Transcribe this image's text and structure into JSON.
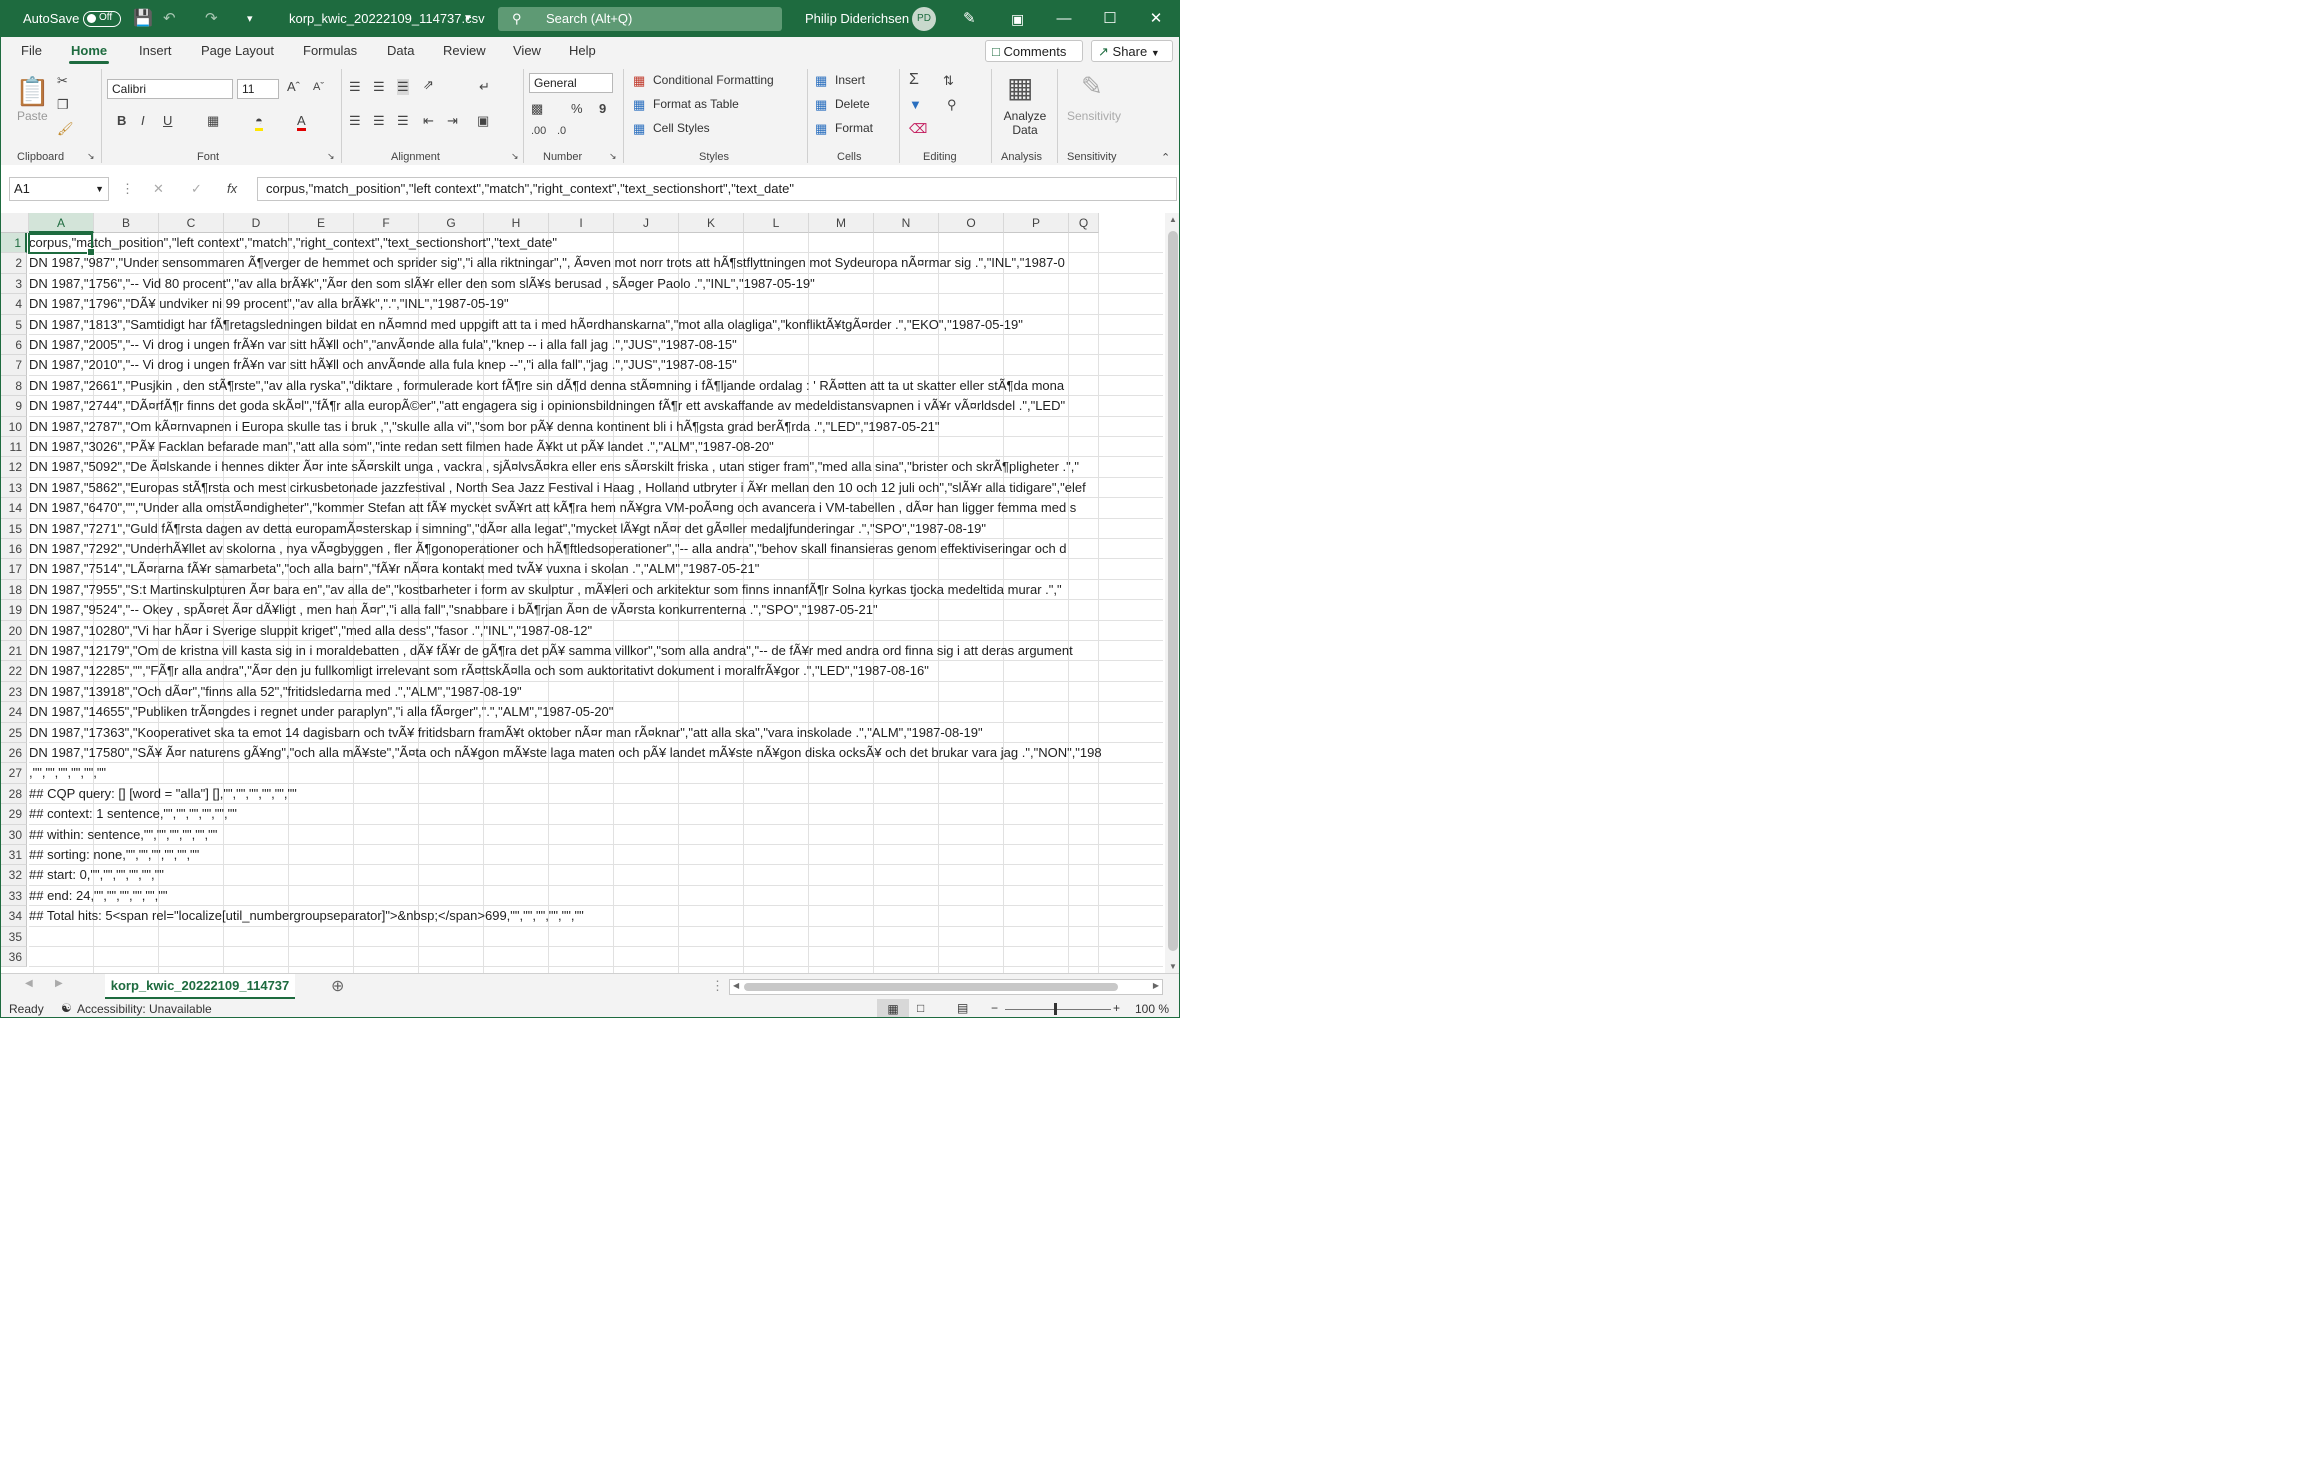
{
  "titlebar": {
    "autosave_label": "AutoSave",
    "autosave_state": "Off",
    "filename": "korp_kwic_20222109_114737.csv",
    "search_placeholder": "Search (Alt+Q)",
    "user_name": "Philip Diderichsen",
    "user_initials": "PD"
  },
  "tabs": [
    "File",
    "Home",
    "Insert",
    "Page Layout",
    "Formulas",
    "Data",
    "Review",
    "View",
    "Help"
  ],
  "tab_actions": {
    "comments": "Comments",
    "share": "Share"
  },
  "ribbon": {
    "clipboard": {
      "paste": "Paste",
      "label": "Clipboard"
    },
    "font": {
      "name": "Calibri",
      "size": "11",
      "label": "Font"
    },
    "alignment": {
      "label": "Alignment"
    },
    "number": {
      "format": "General",
      "label": "Number"
    },
    "styles": {
      "conditional": "Conditional Formatting",
      "table": "Format as Table",
      "cell_styles": "Cell Styles",
      "label": "Styles"
    },
    "cells": {
      "insert": "Insert",
      "delete": "Delete",
      "format": "Format",
      "label": "Cells"
    },
    "editing": {
      "label": "Editing"
    },
    "analysis": {
      "analyze": "Analyze Data",
      "label": "Analysis"
    },
    "sensitivity": {
      "sensitivity": "Sensitivity",
      "label": "Sensitivity"
    }
  },
  "formula_bar": {
    "name_box": "A1",
    "fx": "fx",
    "formula": "corpus,\"match_position\",\"left context\",\"match\",\"right_context\",\"text_sectionshort\",\"text_date\""
  },
  "columns": [
    "A",
    "B",
    "C",
    "D",
    "E",
    "F",
    "G",
    "H",
    "I",
    "J",
    "K",
    "L",
    "M",
    "N",
    "O",
    "P",
    "Q"
  ],
  "rows": [
    "corpus,\"match_position\",\"left context\",\"match\",\"right_context\",\"text_sectionshort\",\"text_date\"",
    "DN 1987,\"987\",\"Under sensommaren Ã¶verger de hemmet och sprider sig\",\"i alla riktningar\",\", Ã¤ven mot norr trots att hÃ¶stflyttningen mot Sydeuropa nÃ¤rmar sig .\",\"INL\",\"1987-0",
    "DN 1987,\"1756\",\"-- Vid 80 procent\",\"av alla brÃ¥k\",\"Ã¤r den som slÃ¥r eller den som slÃ¥s berusad , sÃ¤ger Paolo .\",\"INL\",\"1987-05-19\"",
    "DN 1987,\"1796\",\"DÃ¥ undviker ni 99 procent\",\"av alla brÃ¥k\",\".\",\"INL\",\"1987-05-19\"",
    "DN 1987,\"1813\",\"Samtidigt har fÃ¶retagsledningen bildat en nÃ¤mnd med uppgift att ta i med hÃ¤rdhanskarna\",\"mot alla olagliga\",\"konfliktÃ¥tgÃ¤rder .\",\"EKO\",\"1987-05-19\"",
    "DN 1987,\"2005\",\"-- Vi drog i ungen frÃ¥n var sitt hÃ¥ll och\",\"anvÃ¤nde alla fula\",\"knep -- i alla fall jag .\",\"JUS\",\"1987-08-15\"",
    "DN 1987,\"2010\",\"-- Vi drog i ungen frÃ¥n var sitt hÃ¥ll och anvÃ¤nde alla fula knep --\",\"i alla fall\",\"jag .\",\"JUS\",\"1987-08-15\"",
    "DN 1987,\"2661\",\"Pusjkin , den stÃ¶rste\",\"av alla ryska\",\"diktare , formulerade kort fÃ¶re sin dÃ¶d denna stÃ¤mning i fÃ¶ljande ordalag : ' RÃ¤tten att ta ut skatter eller stÃ¶da mona",
    "DN 1987,\"2744\",\"DÃ¤rfÃ¶r finns det goda skÃ¤l\",\"fÃ¶r alla europÃ©er\",\"att engagera sig i opinionsbildningen fÃ¶r ett avskaffande av medeldistansvapnen i vÃ¥r vÃ¤rldsdel .\",\"LED\"",
    "DN 1987,\"2787\",\"Om kÃ¤rnvapnen i Europa skulle tas i bruk ,\",\"skulle alla vi\",\"som bor pÃ¥ denna kontinent bli i hÃ¶gsta grad berÃ¶rda .\",\"LED\",\"1987-05-21\"",
    "DN 1987,\"3026\",\"PÃ¥ Facklan befarade man\",\"att alla som\",\"inte redan sett filmen hade Ã¥kt ut pÃ¥ landet .\",\"ALM\",\"1987-08-20\"",
    "DN 1987,\"5092\",\"De Ã¤lskande i hennes dikter Ã¤r inte sÃ¤rskilt unga , vackra , sjÃ¤lvsÃ¤kra eller ens sÃ¤rskilt friska , utan stiger fram\",\"med alla sina\",\"brister och skrÃ¶pligheter .\",\"",
    "DN 1987,\"5862\",\"Europas stÃ¶rsta och mest cirkusbetonade jazzfestival , North Sea Jazz Festival i Haag , Holland utbryter i Ã¥r mellan den 10 och 12 juli och\",\"slÃ¥r alla tidigare\",\"elef",
    "DN 1987,\"6470\",\"\",\"Under alla omstÃ¤ndigheter\",\"kommer Stefan att fÃ¥ mycket svÃ¥rt att kÃ¶ra hem nÃ¥gra VM-poÃ¤ng och avancera i VM-tabellen , dÃ¤r han ligger femma med s",
    "DN 1987,\"7271\",\"Guld fÃ¶rsta dagen av detta europamÃ¤sterskap i simning\",\"dÃ¤r alla legat\",\"mycket lÃ¥gt nÃ¤r det gÃ¤ller medaljfunderingar .\",\"SPO\",\"1987-08-19\"",
    "DN 1987,\"7292\",\"UnderhÃ¥llet av skolorna , nya vÃ¤gbyggen , fler Ã¶gonoperationer och hÃ¶ftledsoperationer\",\"-- alla andra\",\"behov skall finansieras genom effektiviseringar och d",
    "DN 1987,\"7514\",\"LÃ¤rarna fÃ¥r samarbeta\",\"och alla barn\",\"fÃ¥r nÃ¤ra kontakt med tvÃ¥ vuxna i skolan .\",\"ALM\",\"1987-05-21\"",
    "DN 1987,\"7955\",\"S:t Martinskulpturen Ã¤r bara en\",\"av alla de\",\"kostbarheter i form av skulptur , mÃ¥leri och arkitektur som finns innanfÃ¶r Solna kyrkas tjocka medeltida murar .\",\"",
    "DN 1987,\"9524\",\"-- Okey , spÃ¤ret Ã¤r dÃ¥ligt , men han Ã¤r\",\"i alla fall\",\"snabbare i bÃ¶rjan Ã¤n de vÃ¤rsta konkurrenterna .\",\"SPO\",\"1987-05-21\"",
    "DN 1987,\"10280\",\"Vi har hÃ¤r i Sverige sluppit kriget\",\"med alla dess\",\"fasor .\",\"INL\",\"1987-08-12\"",
    "DN 1987,\"12179\",\"Om de kristna vill kasta sig in i moraldebatten , dÃ¥ fÃ¥r de gÃ¶ra det pÃ¥ samma villkor\",\"som alla andra\",\"-- de fÃ¥r med andra ord finna sig i att deras argument",
    "DN 1987,\"12285\",\"\",\"FÃ¶r alla andra\",\"Ã¤r den ju fullkomligt irrelevant som rÃ¤ttskÃ¤lla och som auktoritativt dokument i moralfrÃ¥gor .\",\"LED\",\"1987-08-16\"",
    "DN 1987,\"13918\",\"Och dÃ¤r\",\"finns alla 52\",\"fritidsledarna med .\",\"ALM\",\"1987-08-19\"",
    "DN 1987,\"14655\",\"Publiken trÃ¤ngdes i regnet under paraplyn\",\"i alla fÃ¤rger\",\".\",\"ALM\",\"1987-05-20\"",
    "DN 1987,\"17363\",\"Kooperativet ska ta emot 14 dagisbarn och tvÃ¥ fritidsbarn framÃ¥t oktober nÃ¤r man rÃ¤knar\",\"att alla ska\",\"vara inskolade .\",\"ALM\",\"1987-08-19\"",
    "DN 1987,\"17580\",\"SÃ¥ Ã¤r naturens gÃ¥ng\",\"och alla mÃ¥ste\",\"Ã¤ta och nÃ¥gon mÃ¥ste laga maten och pÃ¥ landet mÃ¥ste nÃ¥gon diska ocksÃ¥ och det brukar vara jag .\",\"NON\",\"198",
    ",\"\",\"\",\"\",\"\",\"\",\"\"",
    "## CQP query: [] [word = \"alla\"] [],\"\",\"\",\"\",\"\",\"\",\"\"",
    "## context: 1 sentence,\"\",\"\",\"\",\"\",\"\",\"\"",
    "## within: sentence,\"\",\"\",\"\",\"\",\"\",\"\"",
    "## sorting: none,\"\",\"\",\"\",\"\",\"\",\"\"",
    "## start: 0,\"\",\"\",\"\",\"\",\"\",\"\"",
    "## end: 24,\"\",\"\",\"\",\"\",\"\",\"\"",
    "## Total hits: 5<span rel=\"localize[util_numbergroupseparator]\">&nbsp;</span>699,\"\",\"\",\"\",\"\",\"\",\"\"",
    "",
    ""
  ],
  "sheet_tab": "korp_kwic_20222109_114737",
  "status": {
    "ready": "Ready",
    "accessibility": "Accessibility: Unavailable",
    "zoom": "100 %"
  }
}
